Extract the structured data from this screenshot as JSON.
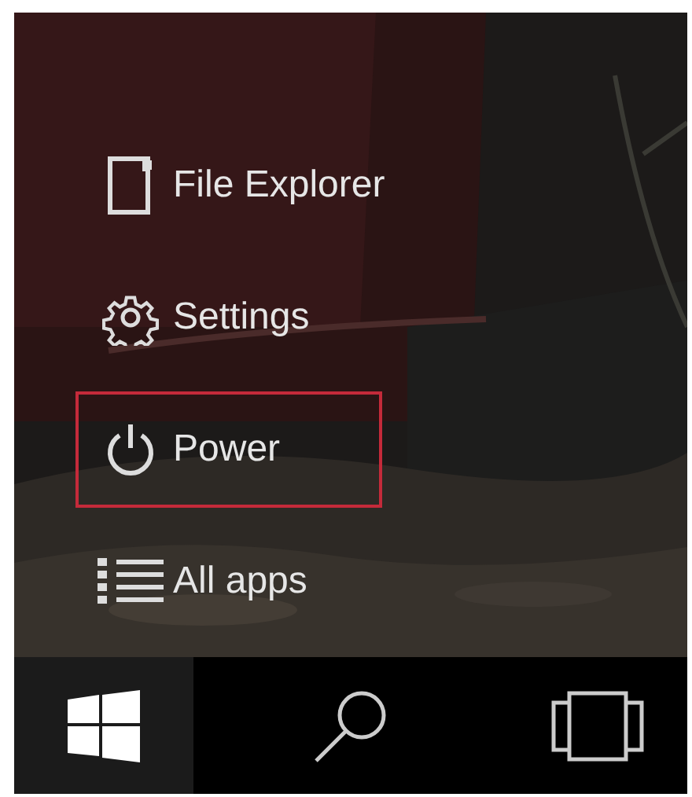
{
  "menu_items": [
    {
      "kind": "file",
      "label": "File Explorer",
      "highlighted": false
    },
    {
      "kind": "settings",
      "label": "Settings",
      "highlighted": false
    },
    {
      "kind": "power",
      "label": "Power",
      "highlighted": true
    },
    {
      "kind": "apps",
      "label": "All apps",
      "highlighted": false
    }
  ],
  "taskbar": [
    {
      "kind": "start"
    },
    {
      "kind": "search"
    },
    {
      "kind": "taskview"
    }
  ]
}
